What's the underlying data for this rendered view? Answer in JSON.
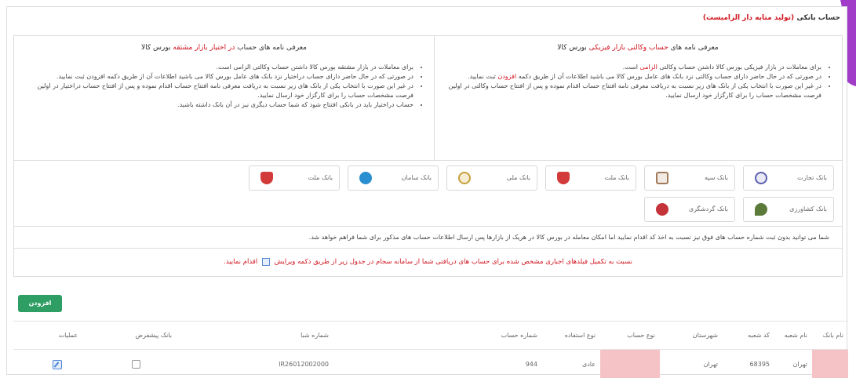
{
  "title": {
    "text": "حساب بانکی",
    "required_note": "(تولید متابه دار الزامیست)"
  },
  "columns": [
    {
      "id": "physical",
      "head_prefix": "معرفی نامه های",
      "head_highlight": "حساب وکالتی بازار فیزیکی",
      "head_suffix": "بورس کالا",
      "bullets": [
        {
          "text": "برای معاملات در بازار فیزیکی بورس کالا داشتن حساب وکالتی",
          "highlight": "الزامی",
          "suffix": "است."
        },
        {
          "text": "در صورتی که در حال حاضر دارای حساب وکالتی نزد بانک های عامل بورس کالا می باشید اطلاعات آن از طریق دکمه",
          "highlight": "افزودن",
          "suffix": "ثبت نمایید."
        },
        {
          "text": "در غیر این صورت با انتخاب یکی از بانک های زیر نسبت به دریافت معرفی نامه افتتاح حساب اقدام نموده و پس از افتتاح حساب وکالتی در اولین فرصت مشخصات حساب را برای کارگزار خود ارسال نمایید.",
          "highlight": "",
          "suffix": ""
        }
      ]
    },
    {
      "id": "derivative",
      "head_prefix": "معرفی نامه های حساب",
      "head_highlight": "در اختیار بازار مشتقه",
      "head_suffix": "بورس کالا",
      "bullets": [
        {
          "text": "برای معاملات در بازار مشتقه بورس کالا داشتن حساب وکالتی الزامی است.",
          "highlight": "",
          "suffix": ""
        },
        {
          "text": "در صورتی که در حال حاضر دارای حساب دراختیار نزد بانک های عامل بورس کالا می باشید اطلاعات آن از طریق دکمه افزودن ثبت نمایید.",
          "highlight": "",
          "suffix": ""
        },
        {
          "text": "در غیر این صورت با انتخاب یکی از بانک های زیر نسبت به دریافت معرفی نامه افتتاح حساب اقدام نموده و پس از افتتاح حساب دراختیار در اولین فرصت مشخصات حساب را برای کارگزار خود ارسال نمایید.",
          "highlight": "",
          "suffix": ""
        },
        {
          "text": "حساب دراختیار باید در بانکی افتتاح شود که شما حساب دیگری نیز در آن بانک داشته باشید.",
          "highlight": "",
          "suffix": ""
        }
      ]
    }
  ],
  "banks": [
    {
      "name": "بانک تجارت",
      "logo": "tejarat-logo",
      "color": "#5a5fb0"
    },
    {
      "name": "بانک سپه",
      "logo": "sepah-logo",
      "color": "#a07a5a"
    },
    {
      "name": "بانک ملت",
      "logo": "mellat-logo",
      "color": "#d33a3a"
    },
    {
      "name": "بانک ملی",
      "logo": "melli-logo",
      "color": "#c8a03c"
    },
    {
      "name": "بانک سامان",
      "logo": "saman-logo",
      "color": "#2a8fd0"
    },
    {
      "name": "بانک ملت",
      "logo": "mellat-logo",
      "color": "#d33a3a"
    },
    {
      "name": "بانک کشاورزی",
      "logo": "keshavarzi-logo",
      "color": "#5c7a3a"
    },
    {
      "name": "بانک گردشگری",
      "logo": "gardeshgari-logo",
      "color": "#c4323a"
    }
  ],
  "notice": "شما می توانید بدون ثبت شماره حساب های فوق نیز نسبت به اخذ کد اقدام نمایید اما امکان معامله در بورس کالا در هریک از بازارها پس ارسال اطلاعات حساب های مذکور برای شما فراهم خواهد شد.",
  "alert": {
    "before": "نسبت به تکمیل فیلدهای اجباری مشخص شده برای حساب های دریافتی شما از سامانه سجام در جدول زیر از طریق دکمه ویرایش",
    "after": "اقدام نمایید."
  },
  "add_button": "افزودن",
  "table": {
    "headers": [
      "نام بانک",
      "نام شعبه",
      "کد شعبه",
      "شهرستان",
      "نوع حساب",
      "نوع استفاده",
      "شماره حساب",
      "شماره شبا",
      "بانک پیشفرض",
      "عملیات"
    ],
    "row": {
      "bank_name": "",
      "branch_name": "تهران",
      "branch_code": "68395",
      "city": "تهران",
      "account_type": "",
      "usage_type": "عادی",
      "account_number": "944",
      "sheba": "IR26012002000",
      "default_bank": false
    },
    "pink_color": "#f5c3c6"
  },
  "accent_colors": {
    "red": "#d0141e",
    "green": "#2e9e64",
    "purple": "#a13cc8"
  }
}
